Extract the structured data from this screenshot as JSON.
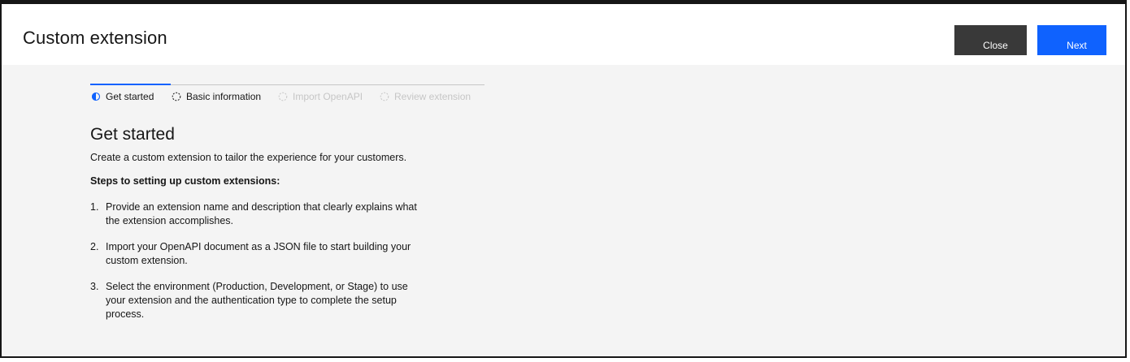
{
  "header": {
    "title": "Custom extension",
    "close_label": "Close",
    "next_label": "Next"
  },
  "colors": {
    "primary": "#0f62fe",
    "secondary_button": "#393939",
    "background": "#f4f4f4",
    "disabled_text": "#c6c6c6"
  },
  "stepper": {
    "steps": [
      {
        "label": "Get started",
        "state": "current",
        "icon": "half-filled-circle-icon"
      },
      {
        "label": "Basic information",
        "state": "incomplete",
        "icon": "dashed-circle-icon"
      },
      {
        "label": "Import OpenAPI",
        "state": "disabled",
        "icon": "dashed-circle-icon"
      },
      {
        "label": "Review extension",
        "state": "disabled",
        "icon": "dashed-circle-icon"
      }
    ]
  },
  "main": {
    "heading": "Get started",
    "intro": "Create a custom extension to tailor the experience for your customers.",
    "steps_heading": "Steps to setting up custom extensions:",
    "items": [
      {
        "num": "1.",
        "text": "Provide an extension name and description that clearly explains what the extension accomplishes."
      },
      {
        "num": "2.",
        "text": "Import your OpenAPI document as a JSON file to start building your custom extension."
      },
      {
        "num": "3.",
        "text": "Select the environment (Production, Development, or Stage) to use your extension and the authentication type to complete the setup process."
      }
    ]
  }
}
